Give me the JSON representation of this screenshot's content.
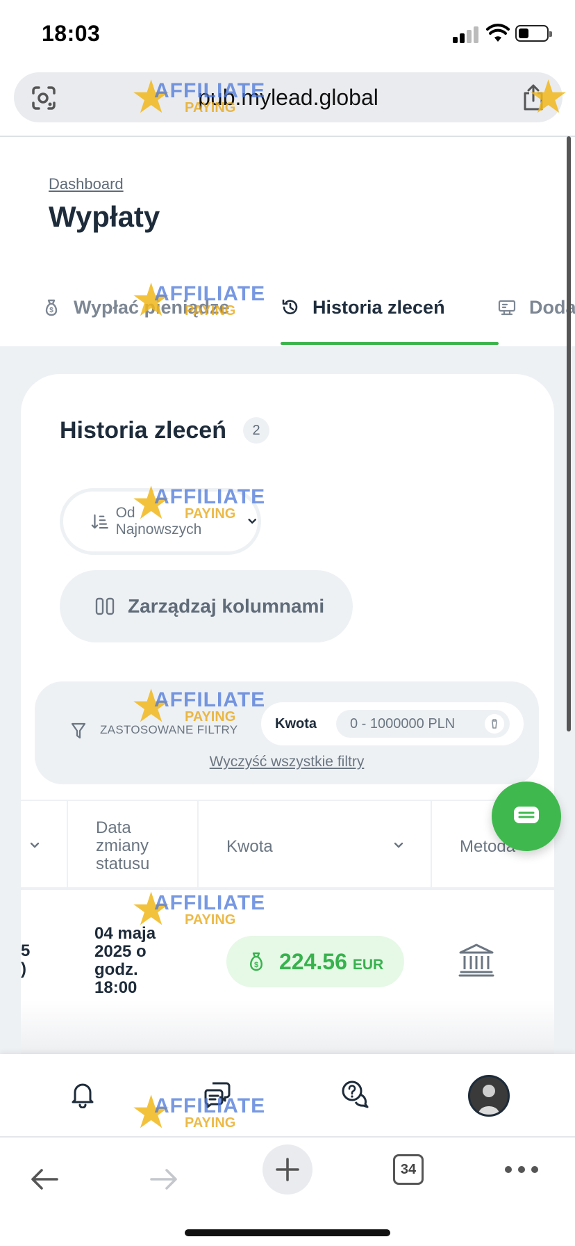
{
  "status_bar": {
    "time": "18:03"
  },
  "browser": {
    "url": "pub.mylead.global",
    "tab_count": "34"
  },
  "page": {
    "breadcrumb": "Dashboard",
    "title": "Wypłaty"
  },
  "tabs": [
    {
      "label": "Wypłać pieniądze",
      "icon": "money-bag-icon"
    },
    {
      "label": "Historia zleceń",
      "icon": "history-icon",
      "active": true
    },
    {
      "label": "Doda",
      "icon": "add-method-icon"
    }
  ],
  "history": {
    "title": "Historia zleceń",
    "count": "2",
    "sort_label": "Od Najnowszych",
    "manage_columns_label": "Zarządzaj kolumnami",
    "filters": {
      "label": "ZASTOSOWANE FILTRY",
      "chip_key": "Kwota",
      "chip_value": "0  -  1000000 PLN",
      "clear_label": "Wyczyść wszystkie filtry"
    },
    "table": {
      "headers": {
        "date_changed": "Data\nzmiany\nstatusu",
        "amount": "Kwota",
        "method": "Metoda"
      },
      "rows": [
        {
          "left_fragment_1": "5",
          "left_fragment_2": ")",
          "date": " 04 maja\n2025 o\ngodz.\n18:00",
          "amount": "224.56",
          "currency": "EUR",
          "method_icon": "bank-icon"
        }
      ]
    }
  },
  "watermark": {
    "brand": "AFFILIATE",
    "tagline": "PAYING"
  },
  "colors": {
    "accent_green": "#3bb44a",
    "amount_green": "#37b24d",
    "amount_bg": "#e6f8e6",
    "section_bg": "#eef1f4",
    "title_dark": "#1d2b3a"
  }
}
